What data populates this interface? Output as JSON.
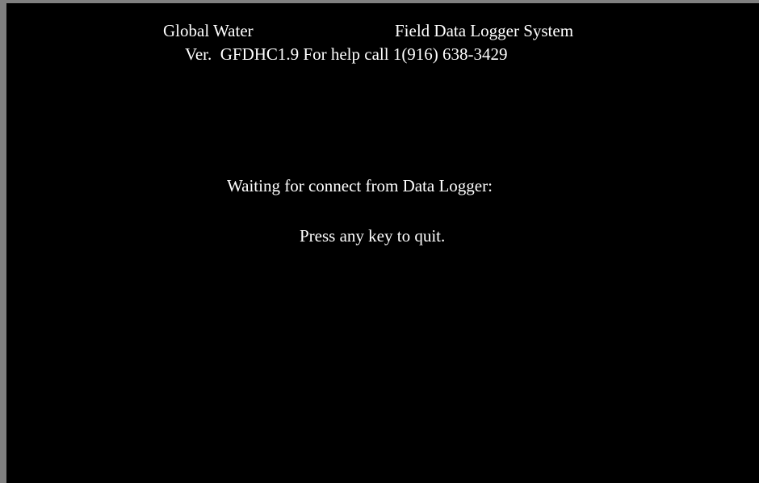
{
  "header": {
    "company": "Global Water",
    "system": "Field Data Logger System",
    "version_line": "Ver.  GFDHC1.9 For help call 1(916) 638-3429"
  },
  "status": {
    "waiting": "Waiting for connect from Data Logger:",
    "quit_hint": "Press any key to quit."
  },
  "colors": {
    "screen_background": "#000000",
    "text": "#ffffff",
    "frame": "#808080"
  }
}
